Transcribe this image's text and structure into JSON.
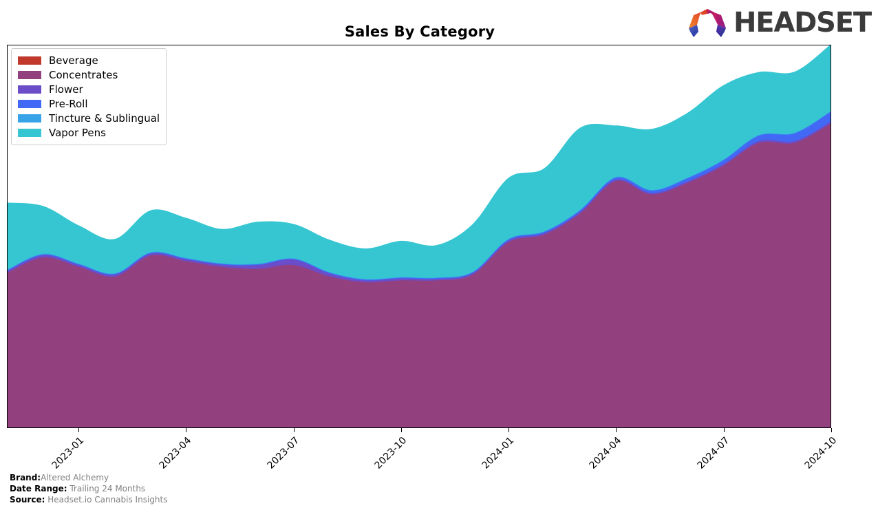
{
  "header": {
    "title": "Sales By Category",
    "logo": {
      "name": "headset-logo",
      "wordmark": "HEADSET",
      "colors": [
        "#F28C28",
        "#D62828",
        "#C2185B",
        "#8E24AA",
        "#3F51B5",
        "#2962FF"
      ]
    }
  },
  "legend": {
    "position": "top-left",
    "items": [
      {
        "label": "Beverage",
        "color": "#C0392B"
      },
      {
        "label": "Concentrates",
        "color": "#93417E"
      },
      {
        "label": "Flower",
        "color": "#6B4DC9"
      },
      {
        "label": "Pre-Roll",
        "color": "#4169F5"
      },
      {
        "label": "Tincture & Sublingual",
        "color": "#38A3E8"
      },
      {
        "label": "Vapor Pens",
        "color": "#35C6D2"
      }
    ]
  },
  "footer": {
    "rows": [
      {
        "key": "Brand:",
        "value": "Altered Alchemy"
      },
      {
        "key": "Date Range:",
        "value": " Trailing 24 Months"
      },
      {
        "key": "Source:",
        "value": " Headset.io Cannabis Insights"
      }
    ]
  },
  "chart_data": {
    "type": "area",
    "stacked": true,
    "title": "Sales By Category",
    "xlabel": "",
    "ylabel": "",
    "grid": false,
    "legend_position": "upper left",
    "axis_tick_labels": [
      "2023-01",
      "2023-04",
      "2023-07",
      "2023-10",
      "2024-01",
      "2024-04",
      "2024-07",
      "2024-10"
    ],
    "axis_tick_months": [
      "2022-11",
      "2023-01",
      "2023-04",
      "2023-07",
      "2023-10",
      "2024-01",
      "2024-04",
      "2024-07",
      "2024-10"
    ],
    "x": [
      "2022-11",
      "2022-12",
      "2023-01",
      "2023-02",
      "2023-03",
      "2023-04",
      "2023-05",
      "2023-06",
      "2023-07",
      "2023-08",
      "2023-09",
      "2023-10",
      "2023-11",
      "2023-12",
      "2024-01",
      "2024-02",
      "2024-03",
      "2024-04",
      "2024-05",
      "2024-06",
      "2024-07",
      "2024-08",
      "2024-09",
      "2024-10"
    ],
    "ylim": [
      0,
      100
    ],
    "series": [
      {
        "name": "Beverage",
        "color": "#C0392B",
        "values": [
          0,
          0,
          0,
          0,
          0,
          0,
          0,
          0,
          0,
          0,
          0,
          0,
          0,
          0,
          0,
          0,
          0,
          0,
          0,
          0,
          0,
          0,
          0,
          0
        ]
      },
      {
        "name": "Concentrates",
        "color": "#93417E",
        "values": [
          40.5,
          44.5,
          42.0,
          39.5,
          45.0,
          43.5,
          42.0,
          41.5,
          42.5,
          39.5,
          38.0,
          38.5,
          38.5,
          40.0,
          48.5,
          50.5,
          56.0,
          64.5,
          61.0,
          64.0,
          68.5,
          74.5,
          74.5,
          79.5
        ]
      },
      {
        "name": "Flower",
        "color": "#6B4DC9",
        "values": [
          0.5,
          0.6,
          0.5,
          0.5,
          0.5,
          0.5,
          0.6,
          1.0,
          1.4,
          0.8,
          0.5,
          0.5,
          0.4,
          0.4,
          0.4,
          0.4,
          0.4,
          0.4,
          0.4,
          0.4,
          0.4,
          0.5,
          0.5,
          0.5
        ]
      },
      {
        "name": "Pre-Roll",
        "color": "#4169F5",
        "values": [
          0.2,
          0.2,
          0.2,
          0.2,
          0.2,
          0.2,
          0.2,
          0.2,
          0.2,
          0.2,
          0.2,
          0.2,
          0.2,
          0.2,
          0.3,
          0.3,
          0.4,
          0.5,
          0.6,
          0.8,
          1.0,
          1.4,
          2.0,
          2.6
        ]
      },
      {
        "name": "Tincture & Sublingual",
        "color": "#38A3E8",
        "values": [
          0.15,
          0.15,
          0.15,
          0.15,
          0.15,
          0.15,
          0.15,
          0.15,
          0.15,
          0.15,
          0.15,
          0.15,
          0.15,
          0.15,
          0.15,
          0.15,
          0.15,
          0.15,
          0.15,
          0.15,
          0.15,
          0.15,
          0.15,
          0.15
        ]
      },
      {
        "name": "Vapor Pens",
        "color": "#35C6D2",
        "values": [
          17.5,
          12.5,
          10.0,
          9.0,
          11.0,
          10.5,
          9.0,
          11.0,
          9.0,
          8.5,
          8.0,
          9.5,
          8.5,
          12.5,
          16.0,
          16.5,
          21.5,
          13.5,
          16.0,
          17.0,
          19.5,
          16.5,
          16.0,
          17.5
        ]
      }
    ]
  }
}
